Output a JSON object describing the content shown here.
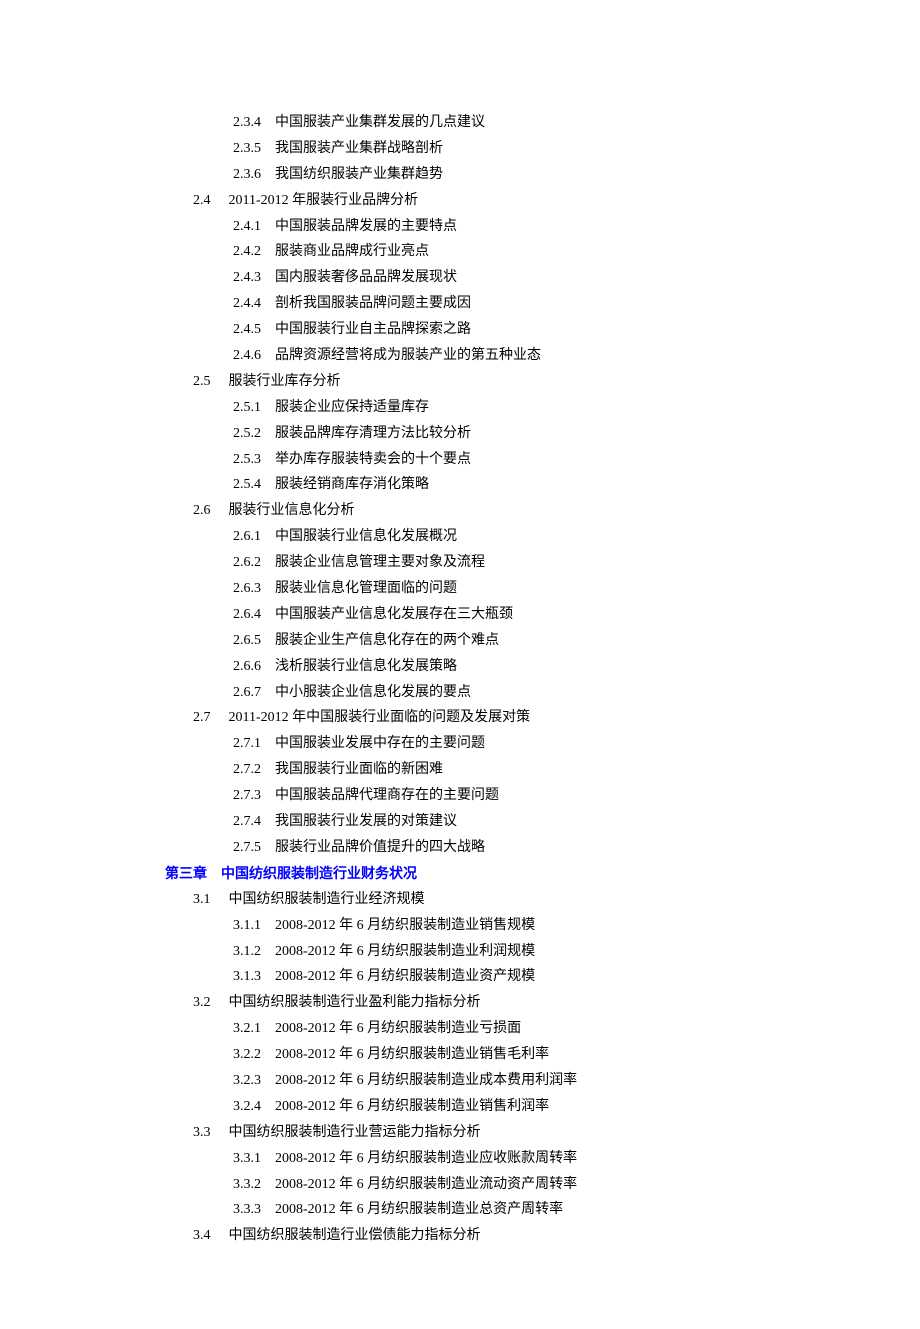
{
  "toc": [
    {
      "level": 2,
      "num": "2.3.4",
      "text": "中国服装产业集群发展的几点建议"
    },
    {
      "level": 2,
      "num": "2.3.5",
      "text": "我国服装产业集群战略剖析"
    },
    {
      "level": 2,
      "num": "2.3.6",
      "text": "我国纺织服装产业集群趋势"
    },
    {
      "level": 1,
      "num": "2.4",
      "text": "2011-2012 年服装行业品牌分析"
    },
    {
      "level": 2,
      "num": "2.4.1",
      "text": "中国服装品牌发展的主要特点"
    },
    {
      "level": 2,
      "num": "2.4.2",
      "text": "服装商业品牌成行业亮点"
    },
    {
      "level": 2,
      "num": "2.4.3",
      "text": "国内服装奢侈品品牌发展现状"
    },
    {
      "level": 2,
      "num": "2.4.4",
      "text": "剖析我国服装品牌问题主要成因"
    },
    {
      "level": 2,
      "num": "2.4.5",
      "text": "中国服装行业自主品牌探索之路"
    },
    {
      "level": 2,
      "num": "2.4.6",
      "text": "品牌资源经营将成为服装产业的第五种业态"
    },
    {
      "level": 1,
      "num": "2.5",
      "text": "服装行业库存分析"
    },
    {
      "level": 2,
      "num": "2.5.1",
      "text": "服装企业应保持适量库存"
    },
    {
      "level": 2,
      "num": "2.5.2",
      "text": "服装品牌库存清理方法比较分析"
    },
    {
      "level": 2,
      "num": "2.5.3",
      "text": "举办库存服装特卖会的十个要点"
    },
    {
      "level": 2,
      "num": "2.5.4",
      "text": "服装经销商库存消化策略"
    },
    {
      "level": 1,
      "num": "2.6",
      "text": "服装行业信息化分析"
    },
    {
      "level": 2,
      "num": "2.6.1",
      "text": "中国服装行业信息化发展概况"
    },
    {
      "level": 2,
      "num": "2.6.2",
      "text": "服装企业信息管理主要对象及流程"
    },
    {
      "level": 2,
      "num": "2.6.3",
      "text": "服装业信息化管理面临的问题"
    },
    {
      "level": 2,
      "num": "2.6.4",
      "text": "中国服装产业信息化发展存在三大瓶颈"
    },
    {
      "level": 2,
      "num": "2.6.5",
      "text": "服装企业生产信息化存在的两个难点"
    },
    {
      "level": 2,
      "num": "2.6.6",
      "text": "浅析服装行业信息化发展策略"
    },
    {
      "level": 2,
      "num": "2.6.7",
      "text": "中小服装企业信息化发展的要点"
    },
    {
      "level": 1,
      "num": "2.7",
      "text": "2011-2012 年中国服装行业面临的问题及发展对策"
    },
    {
      "level": 2,
      "num": "2.7.1",
      "text": "中国服装业发展中存在的主要问题"
    },
    {
      "level": 2,
      "num": "2.7.2",
      "text": "我国服装行业面临的新困难"
    },
    {
      "level": 2,
      "num": "2.7.3",
      "text": "中国服装品牌代理商存在的主要问题"
    },
    {
      "level": 2,
      "num": "2.7.4",
      "text": "我国服装行业发展的对策建议"
    },
    {
      "level": 2,
      "num": "2.7.5",
      "text": "服装行业品牌价值提升的四大战略"
    },
    {
      "level": 0,
      "num": "第三章",
      "text": "中国纺织服装制造行业财务状况",
      "chapter": true
    },
    {
      "level": 1,
      "num": "3.1",
      "text": "中国纺织服装制造行业经济规模"
    },
    {
      "level": 2,
      "num": "3.1.1",
      "text": "2008-2012 年 6 月纺织服装制造业销售规模"
    },
    {
      "level": 2,
      "num": "3.1.2",
      "text": "2008-2012 年 6 月纺织服装制造业利润规模"
    },
    {
      "level": 2,
      "num": "3.1.3",
      "text": "2008-2012 年 6 月纺织服装制造业资产规模"
    },
    {
      "level": 1,
      "num": "3.2",
      "text": "中国纺织服装制造行业盈利能力指标分析"
    },
    {
      "level": 2,
      "num": "3.2.1",
      "text": "2008-2012 年 6 月纺织服装制造业亏损面"
    },
    {
      "level": 2,
      "num": "3.2.2",
      "text": "2008-2012 年 6 月纺织服装制造业销售毛利率"
    },
    {
      "level": 2,
      "num": "3.2.3",
      "text": "2008-2012 年 6 月纺织服装制造业成本费用利润率"
    },
    {
      "level": 2,
      "num": "3.2.4",
      "text": "2008-2012 年 6 月纺织服装制造业销售利润率"
    },
    {
      "level": 1,
      "num": "3.3",
      "text": "中国纺织服装制造行业营运能力指标分析"
    },
    {
      "level": 2,
      "num": "3.3.1",
      "text": "2008-2012 年 6 月纺织服装制造业应收账款周转率"
    },
    {
      "level": 2,
      "num": "3.3.2",
      "text": "2008-2012 年 6 月纺织服装制造业流动资产周转率"
    },
    {
      "level": 2,
      "num": "3.3.3",
      "text": "2008-2012 年 6 月纺织服装制造业总资产周转率"
    },
    {
      "level": 1,
      "num": "3.4",
      "text": "中国纺织服装制造行业偿债能力指标分析"
    }
  ]
}
